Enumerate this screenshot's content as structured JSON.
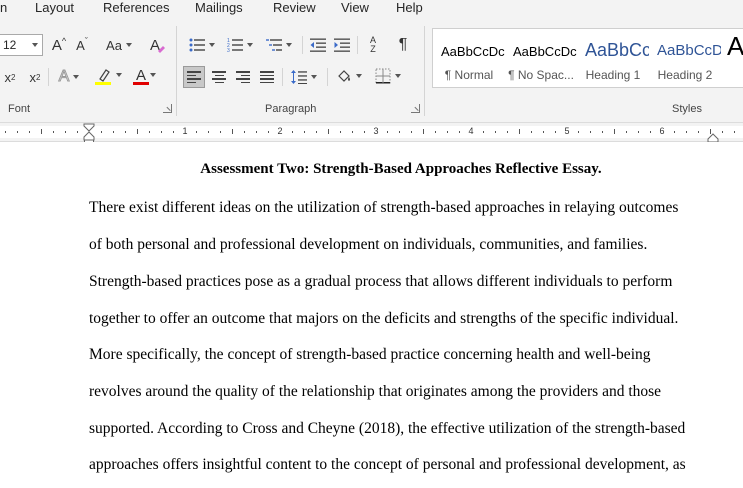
{
  "menu": [
    "n",
    "Layout",
    "References",
    "Mailings",
    "Review",
    "View",
    "Help"
  ],
  "font_group": {
    "font_size": "12",
    "label": "Font",
    "grow_label": "A",
    "shrink_label": "A",
    "case_label": "Aa",
    "subscript_label": "x",
    "subscript_mark": "2",
    "superscript_label": "x",
    "superscript_mark": "2",
    "effects_label": "A",
    "highlight_color": "#ffff00",
    "font_color_label": "A",
    "font_color": "#e00000"
  },
  "paragraph_group": {
    "label": "Paragraph",
    "sort_label": "A",
    "sort_label_2": "Z",
    "pilcrow": "¶"
  },
  "styles_group": {
    "label": "Styles",
    "items": [
      {
        "sample": "AaBbCcDc",
        "name": "¶ Normal"
      },
      {
        "sample": "AaBbCcDc",
        "name": "¶ No Spac..."
      },
      {
        "sample": "AaBbCc",
        "name": "Heading 1"
      },
      {
        "sample": "AaBbCcD",
        "name": "Heading 2"
      },
      {
        "sample": "A",
        "name": ""
      }
    ]
  },
  "ruler": {
    "numbers": [
      "1",
      "2",
      "3",
      "4",
      "5",
      "6"
    ]
  },
  "document": {
    "title": "Assessment Two: Strength-Based Approaches Reflective Essay.",
    "lines": [
      "There exist different ideas on the utilization of strength-based approaches in relaying outcomes",
      "of both personal and professional development on individuals, communities, and families.",
      "Strength-based practices pose as a gradual process that allows different individuals to perform",
      "together to offer an outcome that majors on the deficits and strengths of the specific individual.",
      "More specifically, the concept of strength-based practice concerning health and well-being",
      "revolves around the quality of the relationship that originates among the providers and those",
      "supported. According to Cross and Cheyne (2018), the effective utilization of the strength-based",
      "approaches offers insightful content to the concept of personal and professional development, as"
    ]
  }
}
